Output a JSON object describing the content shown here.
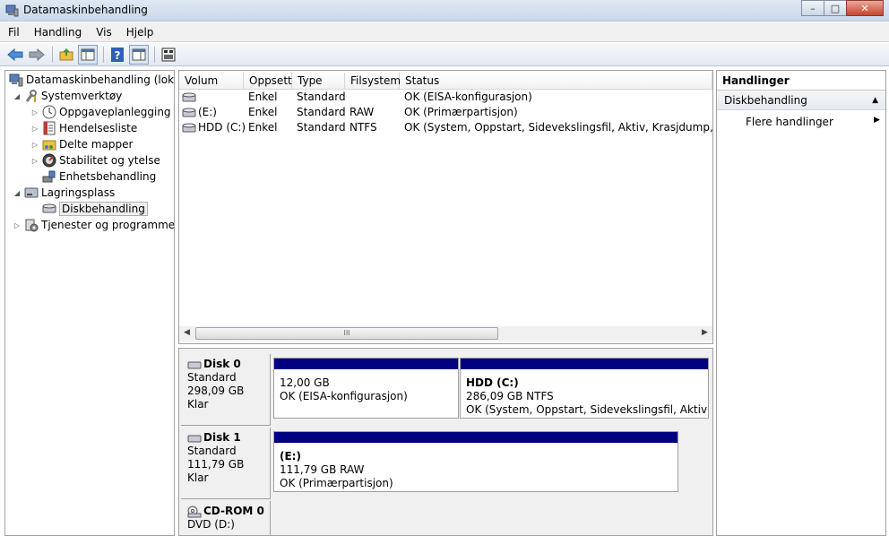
{
  "window": {
    "title": "Datamaskinbehandling",
    "min": "–",
    "max": "□",
    "close": "✕"
  },
  "menu": [
    "Fil",
    "Handling",
    "Vis",
    "Hjelp"
  ],
  "toolbar": {
    "icons": [
      "back-arrow-icon",
      "forward-arrow-icon",
      "folder-up-icon",
      "show-hide-tree-icon",
      "help-icon",
      "properties-icon",
      "console-icon"
    ]
  },
  "tree": {
    "root": "Datamaskinbehandling (lokal)",
    "items": [
      {
        "label": "Systemverktøy",
        "expanded": true
      },
      {
        "label": "Oppgaveplanlegging"
      },
      {
        "label": "Hendelsesliste"
      },
      {
        "label": "Delte mapper"
      },
      {
        "label": "Stabilitet og ytelse"
      },
      {
        "label": "Enhetsbehandling"
      },
      {
        "label": "Lagringsplass",
        "expanded": true
      },
      {
        "label": "Diskbehandling",
        "selected": true
      },
      {
        "label": "Tjenester og programmer"
      }
    ]
  },
  "volumes": {
    "columns": [
      "Volum",
      "Oppsett",
      "Type",
      "Filsystem",
      "Status"
    ],
    "rows": [
      {
        "volum": "",
        "oppsett": "Enkel",
        "type": "Standard",
        "fs": "",
        "status": "OK (EISA-konfigurasjon)"
      },
      {
        "volum": "(E:)",
        "oppsett": "Enkel",
        "type": "Standard",
        "fs": "RAW",
        "status": "OK (Primærpartisjon)"
      },
      {
        "volum": "HDD (C:)",
        "oppsett": "Enkel",
        "type": "Standard",
        "fs": "NTFS",
        "status": "OK (System, Oppstart, Sidevekslingsfil, Aktiv, Krasjdump, Primærp"
      }
    ],
    "scroll_thumb": "III"
  },
  "disks": [
    {
      "name": "Disk 0",
      "kind": "Standard",
      "size": "298,09 GB",
      "state": "Klar",
      "partitions": [
        {
          "name": "",
          "size": "12,00 GB",
          "status": "OK (EISA-konfigurasjon)"
        },
        {
          "name": "HDD  (C:)",
          "size": "286,09 GB NTFS",
          "status": "OK (System, Oppstart, Sidevekslingsfil, Aktiv, Krasj"
        }
      ]
    },
    {
      "name": "Disk 1",
      "kind": "Standard",
      "size": "111,79 GB",
      "state": "Klar",
      "partitions": [
        {
          "name": "(E:)",
          "size": "111,79 GB RAW",
          "status": "OK (Primærpartisjon)"
        }
      ]
    },
    {
      "name": "CD-ROM 0",
      "kind": "DVD (D:)"
    }
  ],
  "actions": {
    "header": "Handlinger",
    "section": "Diskbehandling",
    "item": "Flere handlinger"
  },
  "colors": {
    "partition_bar": "#000080",
    "titlebar": "#c9d8ea"
  }
}
